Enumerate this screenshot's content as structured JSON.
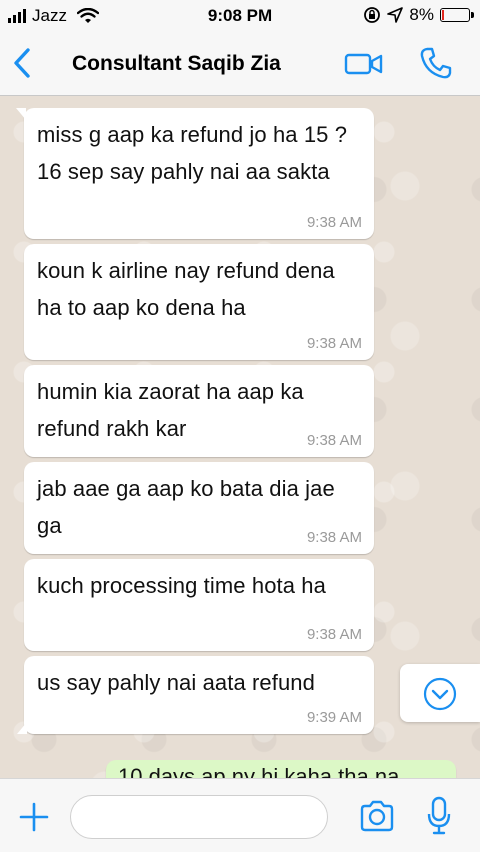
{
  "status_bar": {
    "carrier": "Jazz",
    "time": "9:08 PM",
    "battery": "8%",
    "battery_level": 0.08,
    "battery_color": "#e0281f"
  },
  "nav": {
    "back_icon": "chevron-left-icon",
    "title": "Consultant Saqib Zia",
    "video_icon": "video-camera-icon",
    "call_icon": "phone-icon",
    "accent": "#1a8ff0"
  },
  "messages": [
    {
      "text": "miss g aap ka refund jo ha 15 ?16 sep say pahly nai aa sakta",
      "time": "9:38 AM"
    },
    {
      "text": "koun k airline nay refund dena ha to aap ko dena ha",
      "time": "9:38 AM"
    },
    {
      "text": "humin kia zaorat ha aap ka refund rakh kar",
      "time": "9:38 AM"
    },
    {
      "text": "jab aae ga aap ko bata dia jae  ga",
      "time": "9:38 AM"
    },
    {
      "text": "kuch processing time hota ha",
      "time": "9:38 AM"
    },
    {
      "text": "us say pahly nai aata refund",
      "time": "9:39 AM"
    }
  ],
  "outgoing_partial": {
    "text": "10 days ap ny hi kaha tha na"
  },
  "scroll_down_icon": "chevron-down-circle-icon",
  "input_bar": {
    "attach_icon": "plus-icon",
    "message_placeholder": "",
    "camera_icon": "camera-icon",
    "mic_icon": "microphone-icon"
  },
  "colors": {
    "chat_background": "#e7ded4",
    "incoming_bubble": "#ffffff",
    "outgoing_bubble": "#dcf8c6"
  }
}
